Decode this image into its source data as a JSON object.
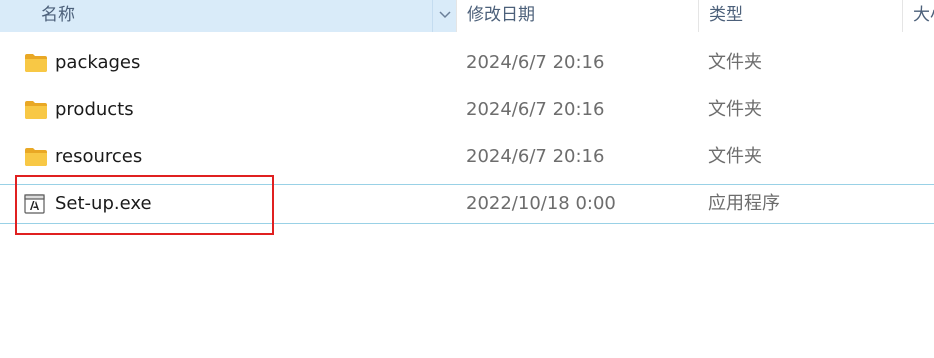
{
  "columns": {
    "name": "名称",
    "date_modified": "修改日期",
    "type": "类型",
    "size": "大小"
  },
  "files": [
    {
      "name": "packages",
      "date": "2024/6/7 20:16",
      "type": "文件夹",
      "icon": "folder-icon"
    },
    {
      "name": "products",
      "date": "2024/6/7 20:16",
      "type": "文件夹",
      "icon": "folder-icon"
    },
    {
      "name": "resources",
      "date": "2024/6/7 20:16",
      "type": "文件夹",
      "icon": "folder-icon"
    },
    {
      "name": "Set-up.exe",
      "date": "2022/10/18 0:00",
      "type": "应用程序",
      "icon": "adobe-installer-icon"
    }
  ],
  "colors": {
    "header_active_bg": "#d9ebf9",
    "selection_border": "#99d1e6",
    "highlight_box": "#e02020",
    "folder_yellow": "#f8c845"
  }
}
